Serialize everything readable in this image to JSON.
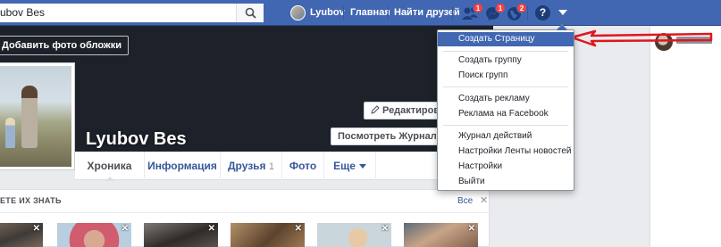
{
  "colors": {
    "brand": "#4267b2",
    "badge": "#fa3e3e",
    "arrow": "#e0161e"
  },
  "topbar": {
    "search_value": "ubov Bes",
    "user_name": "Lyubov",
    "home_label": "Главная",
    "find_friends_label": "Найти друзей",
    "friend_requests_count": "1",
    "messages_count": "1",
    "notifications_count": "2",
    "help_label": "?"
  },
  "profile": {
    "name": "Lyubov Bes",
    "add_cover_label": "Добавить фото обложки",
    "edit_button_label": "Редактировать",
    "activity_log_button_label": "Посмотреть Журнал дейст"
  },
  "tabs": [
    {
      "label": "Хроника"
    },
    {
      "label": "Информация"
    },
    {
      "label": "Друзья",
      "count": "1"
    },
    {
      "label": "Фото"
    },
    {
      "label": "Еще"
    }
  ],
  "pymk": {
    "title": "ЕТЕ ИХ ЗНАТЬ",
    "see_all": "Все",
    "close": "✕",
    "card_close": "✕"
  },
  "menu": {
    "items": [
      "Создать Страницу",
      "Создать группу",
      "Поиск групп",
      "Создать рекламу",
      "Реклама на Facebook",
      "Журнал действий",
      "Настройки Ленты новостей",
      "Настройки",
      "Выйти"
    ]
  }
}
